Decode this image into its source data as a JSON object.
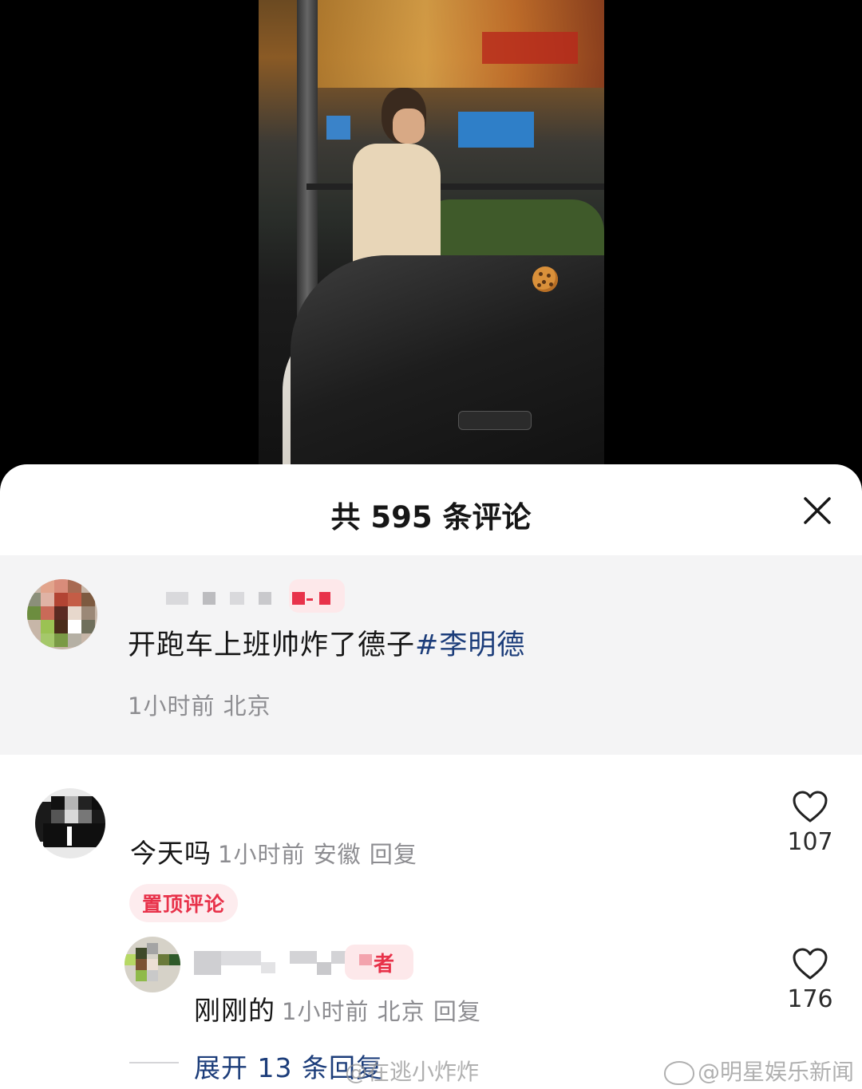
{
  "sheet": {
    "title": "共 595 条评论",
    "close_icon": "close-icon"
  },
  "post": {
    "text": "开跑车上班帅炸了德子",
    "hashtag": "#李明德",
    "time": "1小时前",
    "location": "北京"
  },
  "comments": [
    {
      "text": "今天吗",
      "time": "1小时前",
      "location": "安徽",
      "reply_label": "回复",
      "likes": "107",
      "pin_label": "置顶评论"
    },
    {
      "badge": "者",
      "text": "刚刚的",
      "time": "1小时前",
      "location": "北京",
      "reply_label": "回复",
      "likes": "176"
    }
  ],
  "expand_label": "展开 13 条回复",
  "watermarks": [
    "@在逃小炸炸",
    "@明星娱乐新闻"
  ],
  "colors": {
    "accent_link": "#1c3d7a",
    "pin_red": "#e8324a",
    "meta_gray": "#8d8d91",
    "pinned_bg": "#f4f4f5"
  }
}
